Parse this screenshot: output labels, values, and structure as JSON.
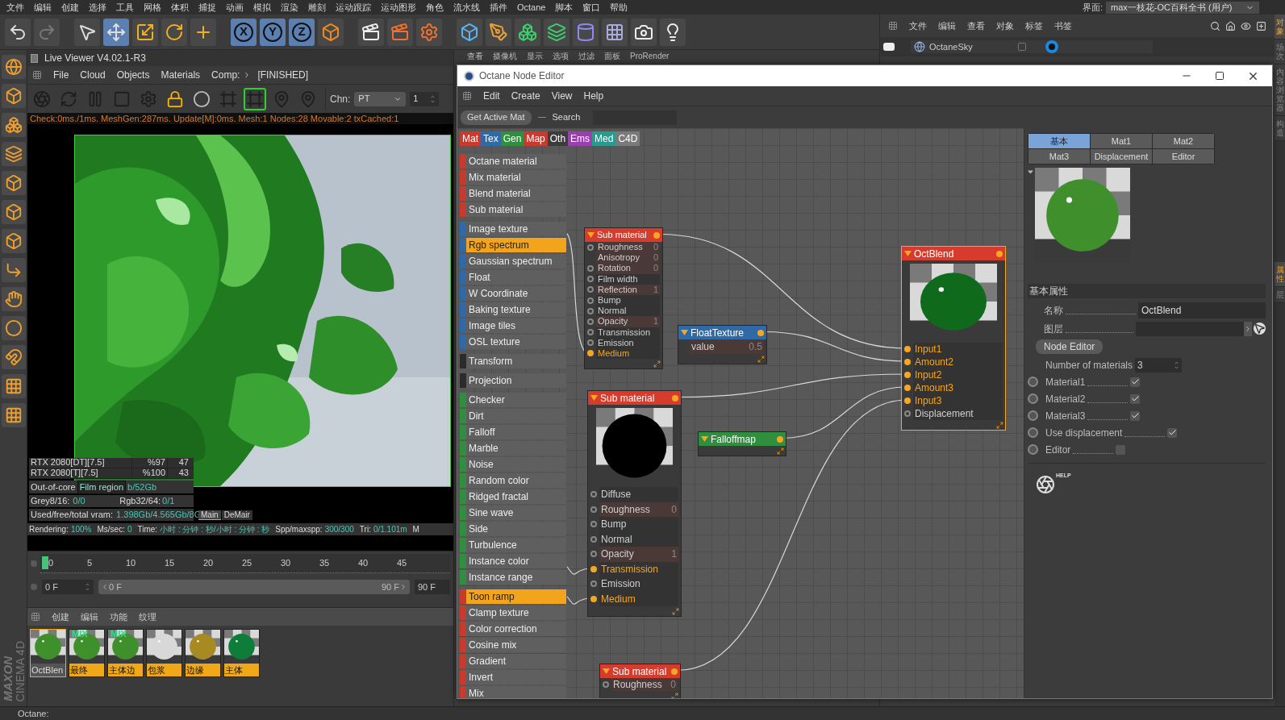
{
  "menu_bar": {
    "items": [
      "文件",
      "编辑",
      "创建",
      "选择",
      "工具",
      "网格",
      "体积",
      "捕捉",
      "动画",
      "模拟",
      "渲染",
      "雕刻",
      "运动跟踪",
      "运动图形",
      "角色",
      "流水线",
      "插件",
      "Octane",
      "脚本",
      "窗口",
      "帮助"
    ],
    "layout_label": "界面:",
    "layout_value": "max一枝花-OC百科全书 (用户)"
  },
  "toolbar": {
    "tools": [
      {
        "kind": "undo",
        "active": false
      },
      {
        "kind": "redo",
        "active": false
      },
      {
        "kind": "select",
        "active": false
      },
      {
        "kind": "move",
        "active": true
      },
      {
        "kind": "scale",
        "active": false
      },
      {
        "kind": "rotate",
        "active": false
      },
      {
        "kind": "add",
        "active": false
      }
    ],
    "axes": [
      {
        "label": "X",
        "active": true
      },
      {
        "label": "Y",
        "active": true
      },
      {
        "label": "Z",
        "active": true
      }
    ],
    "tools2": [
      {
        "kind": "coords",
        "active": false
      },
      {
        "kind": "render_view",
        "active": false
      },
      {
        "kind": "render_picture",
        "active": false
      },
      {
        "kind": "render_settings",
        "active": false
      },
      {
        "kind": "cube",
        "active": false
      },
      {
        "kind": "pen",
        "active": false
      },
      {
        "kind": "subdivide",
        "active": false
      },
      {
        "kind": "array",
        "active": false
      },
      {
        "kind": "deformer",
        "active": false
      },
      {
        "kind": "floor",
        "active": false
      },
      {
        "kind": "camera",
        "active": false
      },
      {
        "kind": "light",
        "active": false
      }
    ]
  },
  "object_manager": {
    "menu": [
      "文件",
      "编辑",
      "查看",
      "对象",
      "标签",
      "书签"
    ],
    "objects": [
      {
        "name": "OctaneSky"
      }
    ]
  },
  "right_tabs_top": [
    {
      "label": "对象",
      "selected": true
    },
    {
      "label": "场次",
      "selected": false
    },
    {
      "label": "内容浏览器",
      "selected": false
    },
    {
      "label": "构造",
      "selected": false
    }
  ],
  "right_tabs_bottom": [
    {
      "label": "属性",
      "selected": true
    },
    {
      "label": "层",
      "selected": false
    }
  ],
  "viewport_menu": [
    "查看",
    "摄像机",
    "显示",
    "选项",
    "过滤",
    "面板",
    "ProRender"
  ],
  "live_viewer": {
    "title": "Live Viewer V4.02.1-R3",
    "menu": [
      "File",
      "Cloud",
      "Objects",
      "Materials",
      "Comp:"
    ],
    "state": "[FINISHED]",
    "tools": [
      {
        "kind": "octane",
        "active": false
      },
      {
        "kind": "restart",
        "active": false
      },
      {
        "kind": "pause",
        "active": false
      },
      {
        "kind": "render",
        "active": false
      },
      {
        "kind": "settings",
        "active": false
      },
      {
        "kind": "lock",
        "active": true
      },
      {
        "kind": "sphere",
        "active": false
      },
      {
        "kind": "region",
        "active": false
      },
      {
        "kind": "film_region",
        "active": true
      },
      {
        "kind": "focus_pick",
        "active": false
      },
      {
        "kind": "material_pick",
        "active": false
      }
    ],
    "channel_label": "Chn:",
    "channel_value": "PT",
    "spin_value": "1",
    "log": "Check:0ms./1ms. MeshGen:287ms. Update[M]:0ms. Mesh:1 Nodes:28 Movable:2 txCached:1",
    "gpus": [
      {
        "name": "RTX 2080[DT][7.5]",
        "usage": "%97",
        "temp": "47"
      },
      {
        "name": "RTX 2080[T][7.5]",
        "usage": "%100",
        "temp": "43"
      }
    ],
    "out_of_core_label": "Out-of-core",
    "out_of_core_value": "b/52Gb",
    "tooltip": "Film region",
    "grey_label": "Grey8/16:",
    "grey_value": "0/0",
    "rgb_label": "Rgb32/64:",
    "rgb_value": "0/1",
    "vram_label": "Used/free/total vram:",
    "vram_value": "1.398Gb/4.565Gb/8G",
    "tabs": [
      {
        "label": "Main",
        "selected": true
      },
      {
        "label": "DeMair",
        "selected": false
      }
    ],
    "stats": [
      {
        "label": "Rendering:",
        "value": "100%"
      },
      {
        "label": "Ms/sec:",
        "value": "0"
      },
      {
        "label": "Time:",
        "value": "小时 : 分钟 : 秒/小时 : 分钟 : 秒"
      },
      {
        "label": "Spp/maxspp:",
        "value": "300/300"
      },
      {
        "label": "Tri:",
        "value": "0/1.101m"
      }
    ],
    "stats_tail": "M"
  },
  "timeline": {
    "ticks": [
      "0",
      "5",
      "10",
      "15",
      "20",
      "25",
      "30",
      "35",
      "40",
      "45"
    ],
    "start": "0 F",
    "range_start": "0 F",
    "range_end": "90 F",
    "end": "90 F",
    "level": 1
  },
  "material_manager": {
    "menu": [
      "创建",
      "编辑",
      "功能",
      "纹理"
    ],
    "materials": [
      {
        "name": "OctBlen",
        "selected": true,
        "kind": "green"
      },
      {
        "name": "最终",
        "selected": false,
        "kind": "green",
        "badge": "MIX"
      },
      {
        "name": "主体边",
        "selected": false,
        "kind": "green",
        "badge": "MIX"
      },
      {
        "name": "包浆",
        "selected": false,
        "kind": "clear"
      },
      {
        "name": "边缘",
        "selected": false,
        "kind": "gold"
      },
      {
        "name": "主体",
        "selected": false,
        "kind": "jade"
      }
    ]
  },
  "brand": {
    "line1": "MAXON",
    "line2": "CINEMA 4D"
  },
  "status_bar": "Octane:",
  "node_editor": {
    "title": "Octane Node Editor",
    "menu": [
      "Edit",
      "Create",
      "View",
      "Help"
    ],
    "get_active": "Get Active Mat",
    "search_label": "Search",
    "categories": [
      {
        "label": "Mat",
        "color": "#c8392e"
      },
      {
        "label": "Tex",
        "color": "#2f6aa6"
      },
      {
        "label": "Gen",
        "color": "#2f8f3e"
      },
      {
        "label": "Map",
        "color": "#c8392e"
      },
      {
        "label": "Oth",
        "color": "#3c3c3c"
      },
      {
        "label": "Ems",
        "color": "#9b3fb0"
      },
      {
        "label": "Med",
        "color": "#2a9a8c"
      },
      {
        "label": "C4D",
        "color": "#7a7a7a"
      }
    ],
    "node_groups": [
      {
        "color": "#c8392e",
        "items": [
          {
            "label": "Octane material",
            "selected": false
          },
          {
            "label": "Mix material",
            "selected": false
          },
          {
            "label": "Blend material",
            "selected": false
          },
          {
            "label": "Sub material",
            "selected": false
          }
        ]
      },
      {
        "color": "#2f6aa6",
        "items": [
          {
            "label": "Image texture",
            "selected": false
          },
          {
            "label": "Rgb spectrum",
            "selected": true
          },
          {
            "label": "Gaussian spectrum",
            "selected": false
          },
          {
            "label": "Float",
            "selected": false
          },
          {
            "label": "W Coordinate",
            "selected": false
          },
          {
            "label": "Baking texture",
            "selected": false
          },
          {
            "label": "Image tiles",
            "selected": false
          },
          {
            "label": "OSL texture",
            "selected": false
          }
        ]
      },
      {
        "color": "#2b2b2b",
        "items": [
          {
            "label": "Transform",
            "selected": false
          }
        ]
      },
      {
        "color": "#2b2b2b",
        "items": [
          {
            "label": "Projection",
            "selected": false
          }
        ]
      },
      {
        "color": "#2f8f3e",
        "items": [
          {
            "label": "Checker",
            "selected": false
          },
          {
            "label": "Dirt",
            "selected": false
          },
          {
            "label": "Falloff",
            "selected": false
          },
          {
            "label": "Marble",
            "selected": false
          },
          {
            "label": "Noise",
            "selected": false
          },
          {
            "label": "Random color",
            "selected": false
          },
          {
            "label": "Ridged fractal",
            "selected": false
          },
          {
            "label": "Sine wave",
            "selected": false
          },
          {
            "label": "Side",
            "selected": false
          },
          {
            "label": "Turbulence",
            "selected": false
          },
          {
            "label": "Instance color",
            "selected": false
          },
          {
            "label": "Instance range",
            "selected": false
          }
        ]
      },
      {
        "color": "#c8392e",
        "items": [
          {
            "label": "Toon ramp",
            "selected": true
          },
          {
            "label": "Clamp texture",
            "selected": false
          },
          {
            "label": "Color correction",
            "selected": false
          },
          {
            "label": "Cosine mix",
            "selected": false
          },
          {
            "label": "Gradient",
            "selected": false
          },
          {
            "label": "Invert",
            "selected": false
          },
          {
            "label": "Mix",
            "selected": false
          }
        ]
      }
    ],
    "nodes": [
      {
        "title": "Sub material",
        "color": "#d63b2c",
        "selected": false,
        "pins": [
          {
            "label": "Roughness",
            "value": "0",
            "socket": true,
            "connected": false
          },
          {
            "label": "Anisotropy",
            "value": "0",
            "socket": false,
            "connected": false
          },
          {
            "label": "Rotation",
            "value": "0",
            "socket": true,
            "connected": false
          },
          {
            "label": "Film width",
            "socket": true,
            "connected": false
          },
          {
            "label": "Reflection",
            "value": "1",
            "socket": true,
            "connected": false
          },
          {
            "label": "Bump",
            "socket": true,
            "connected": false
          },
          {
            "label": "Normal",
            "socket": true,
            "connected": false
          },
          {
            "label": "Opacity",
            "value": "1",
            "socket": true,
            "connected": false
          },
          {
            "label": "Transmission",
            "socket": true,
            "connected": false
          },
          {
            "label": "Emission",
            "socket": true,
            "connected": false
          },
          {
            "label": "Medium",
            "socket": true,
            "connected": true
          }
        ]
      },
      {
        "title": "FloatTexture",
        "color": "#2f6aa6",
        "selected": false,
        "pins": [
          {
            "label": "value",
            "value": "0.5",
            "socket": false,
            "connected": false
          }
        ]
      },
      {
        "title": "OctBlend",
        "color": "#d63b2c",
        "selected": true,
        "preview": {
          "kind": "deep"
        },
        "pins": [
          {
            "label": "Input1",
            "socket": true,
            "connected": true
          },
          {
            "label": "Amount2",
            "socket": true,
            "connected": true
          },
          {
            "label": "Input2",
            "socket": true,
            "connected": true
          },
          {
            "label": "Amount3",
            "socket": true,
            "connected": true
          },
          {
            "label": "Input3",
            "socket": true,
            "connected": true
          },
          {
            "label": "Displacement",
            "socket": true,
            "connected": false
          }
        ]
      },
      {
        "title": "Sub material",
        "color": "#d63b2c",
        "selected": false,
        "preview": {
          "kind": "black"
        },
        "pins": [
          {
            "label": "Diffuse",
            "socket": true,
            "connected": false
          },
          {
            "label": "Roughness",
            "value": "0",
            "socket": true,
            "connected": false
          },
          {
            "label": "Bump",
            "socket": true,
            "connected": false
          },
          {
            "label": "Normal",
            "socket": true,
            "connected": false
          },
          {
            "label": "Opacity",
            "value": "1",
            "socket": true,
            "connected": false
          },
          {
            "label": "Transmission",
            "socket": true,
            "connected": true
          },
          {
            "label": "Emission",
            "socket": true,
            "connected": false
          },
          {
            "label": "Medium",
            "socket": true,
            "connected": true
          }
        ]
      },
      {
        "title": "Falloffmap",
        "color": "#2f8f3e",
        "selected": false
      },
      {
        "title": "Sub material",
        "color": "#d63b2c",
        "selected": false,
        "pins": [
          {
            "label": "Roughness",
            "value": "0",
            "socket": true,
            "connected": false
          }
        ]
      }
    ],
    "panel": {
      "tabs": [
        {
          "label": "基本",
          "selected": true
        },
        {
          "label": "Mat1",
          "selected": false
        },
        {
          "label": "Mat2",
          "selected": false
        },
        {
          "label": "Mat3",
          "selected": false
        },
        {
          "label": "Displacement",
          "selected": false
        },
        {
          "label": "Editor",
          "selected": false
        }
      ],
      "section": "基本属性",
      "name_label": "名称",
      "name_value": "OctBlend",
      "layer_label": "图层",
      "node_editor_button": "Node Editor",
      "count_label": "Number of materials",
      "count_value": "3",
      "options": [
        {
          "label": "Material1",
          "checked": true
        },
        {
          "label": "Material2",
          "checked": true
        },
        {
          "label": "Material3",
          "checked": true
        },
        {
          "label": "Use displacement",
          "checked": true
        },
        {
          "label": "Editor",
          "checked": false
        }
      ],
      "help": "HELP"
    }
  }
}
